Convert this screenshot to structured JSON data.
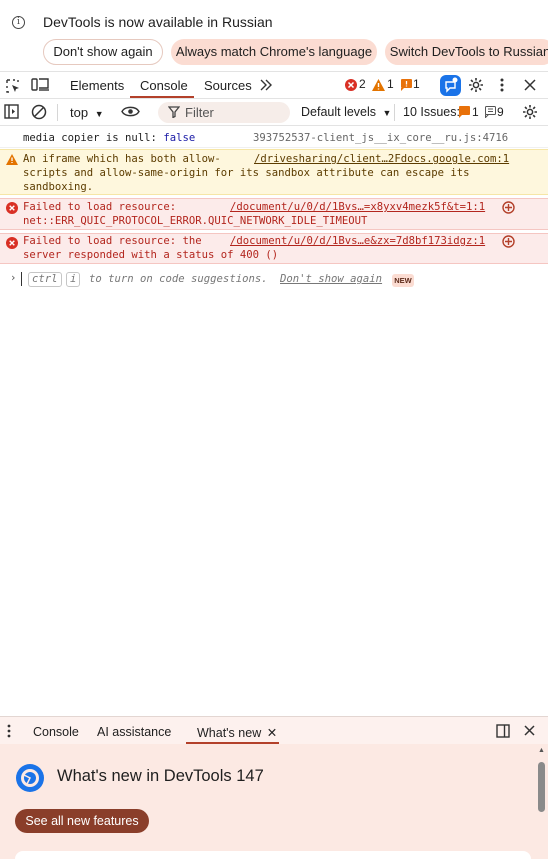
{
  "infobar": {
    "message": "DevTools is now available in Russian",
    "dont_show": "Don't show again",
    "always_match": "Always match Chrome's language",
    "switch": "Switch DevTools to Russian"
  },
  "main_tabs": {
    "elements": "Elements",
    "console": "Console",
    "sources": "Sources",
    "errors": "2",
    "warnings": "1",
    "issues": "1"
  },
  "console_bar": {
    "context": "top",
    "filter_placeholder": "Filter",
    "levels": "Default levels",
    "issues_label": "10 Issues:",
    "issues_errors": "1",
    "issues_info": "9"
  },
  "messages": [
    {
      "level": "log",
      "text": "media copier is null:",
      "value": "false",
      "source": "393752537-client_js__ix_core__ru.js:4716"
    },
    {
      "level": "warning",
      "line1": "An iframe which has both allow-",
      "line2": "scripts and allow-same-origin for its sandbox attribute can escape its",
      "line3": "sandboxing.",
      "source": "/drivesharing/client…2Fdocs.google.com:1"
    },
    {
      "level": "error",
      "line1": "Failed to load resource:",
      "line2": "net::ERR_QUIC_PROTOCOL_ERROR.QUIC_NETWORK_IDLE_TIMEOUT",
      "source": "/document/u/0/d/1Bvs…=x8yxv4mezk5f&t=1:1"
    },
    {
      "level": "error",
      "line1": "Failed to load resource: the",
      "line2": "server responded with a status of 400 ()",
      "source": "/document/u/0/d/1Bvs…e&zx=7d8bf173idgz:1"
    }
  ],
  "prompt": {
    "key1": "ctrl",
    "key2": "i",
    "hint": "to turn on code suggestions.",
    "dont_show": "Don't show again",
    "badge": "NEW"
  },
  "drawer": {
    "tab_console": "Console",
    "tab_ai": "AI assistance",
    "tab_whats_new": "What's new",
    "title": "What's new in DevTools 147",
    "see_all": "See all new features"
  },
  "colors": {
    "accent": "#b3402a",
    "error": "#d93025",
    "warning": "#e37400",
    "info_flag": "#e8710a",
    "chrome_blue": "#1a73e8"
  }
}
